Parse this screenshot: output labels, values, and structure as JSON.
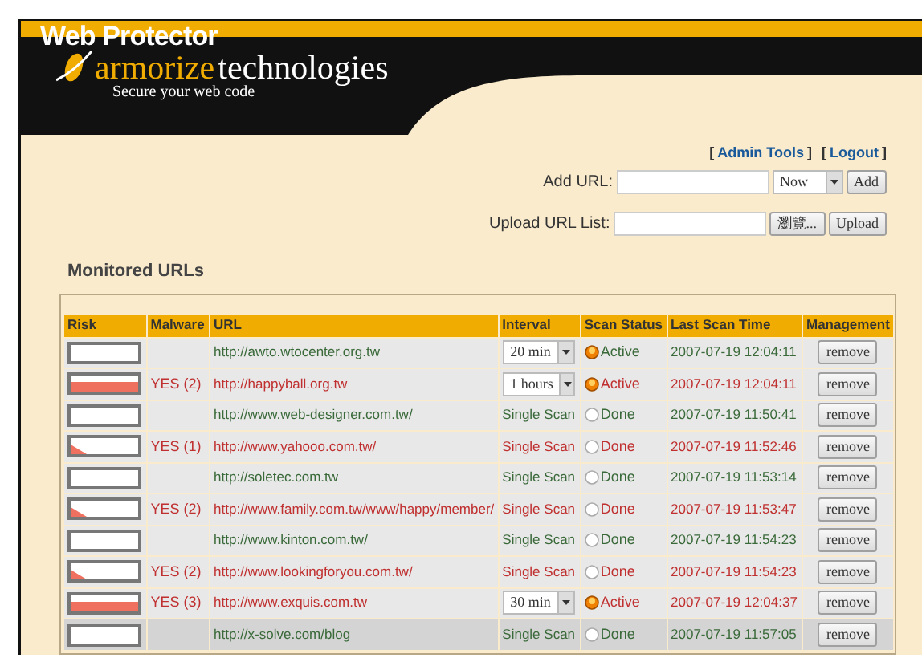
{
  "app": {
    "title": "Web Protector",
    "brand": "armorize",
    "brand_suffix": "technologies",
    "tagline": "Secure your web code"
  },
  "links": [
    {
      "open": "[",
      "label": "Admin Tools",
      "close": "]"
    },
    {
      "open": "[",
      "label": "Logout",
      "close": "]"
    }
  ],
  "add_url": {
    "label": "Add URL:",
    "schedule": "Now",
    "button": "Add"
  },
  "upload": {
    "label": "Upload URL List:",
    "browse": "瀏覽...",
    "button": "Upload"
  },
  "section_title": "Monitored URLs",
  "table": {
    "columns": [
      "Risk",
      "Malware",
      "URL",
      "Interval",
      "Scan Status",
      "Last Scan Time",
      "Management"
    ],
    "rows": [
      {
        "risk": {
          "kind": "none"
        },
        "malware": "",
        "url": "http://awto.wtocenter.org.tw",
        "interval": {
          "kind": "select",
          "label": "20 min"
        },
        "status": {
          "kind": "active",
          "label": "Active"
        },
        "time": "2007-07-19 12:04:11",
        "action": "remove",
        "flagged": false,
        "selected": false
      },
      {
        "risk": {
          "kind": "bar"
        },
        "malware": "YES (2)",
        "url": "http://happyball.org.tw",
        "interval": {
          "kind": "select",
          "label": "1 hours"
        },
        "status": {
          "kind": "active",
          "label": "Active"
        },
        "time": "2007-07-19 12:04:11",
        "action": "remove",
        "flagged": true,
        "selected": false
      },
      {
        "risk": {
          "kind": "none"
        },
        "malware": "",
        "url": "http://www.web-designer.com.tw/",
        "interval": {
          "kind": "text",
          "label": "Single Scan"
        },
        "status": {
          "kind": "done",
          "label": "Done"
        },
        "time": "2007-07-19 11:50:41",
        "action": "remove",
        "flagged": false,
        "selected": false
      },
      {
        "risk": {
          "kind": "wedge"
        },
        "malware": "YES (1)",
        "url": "http://www.yahooo.com.tw/",
        "interval": {
          "kind": "text",
          "label": "Single Scan"
        },
        "status": {
          "kind": "done",
          "label": "Done"
        },
        "time": "2007-07-19 11:52:46",
        "action": "remove",
        "flagged": true,
        "selected": false
      },
      {
        "risk": {
          "kind": "none"
        },
        "malware": "",
        "url": "http://soletec.com.tw",
        "interval": {
          "kind": "text",
          "label": "Single Scan"
        },
        "status": {
          "kind": "done",
          "label": "Done"
        },
        "time": "2007-07-19 11:53:14",
        "action": "remove",
        "flagged": false,
        "selected": false
      },
      {
        "risk": {
          "kind": "wedge"
        },
        "malware": "YES (2)",
        "url": "http://www.family.com.tw/www/happy/member/",
        "interval": {
          "kind": "text",
          "label": "Single Scan"
        },
        "status": {
          "kind": "done",
          "label": "Done"
        },
        "time": "2007-07-19 11:53:47",
        "action": "remove",
        "flagged": true,
        "selected": false
      },
      {
        "risk": {
          "kind": "none"
        },
        "malware": "",
        "url": "http://www.kinton.com.tw/",
        "interval": {
          "kind": "text",
          "label": "Single Scan"
        },
        "status": {
          "kind": "done",
          "label": "Done"
        },
        "time": "2007-07-19 11:54:23",
        "action": "remove",
        "flagged": false,
        "selected": false
      },
      {
        "risk": {
          "kind": "wedge"
        },
        "malware": "YES (2)",
        "url": "http://www.lookingforyou.com.tw/",
        "interval": {
          "kind": "text",
          "label": "Single Scan"
        },
        "status": {
          "kind": "done",
          "label": "Done"
        },
        "time": "2007-07-19 11:54:23",
        "action": "remove",
        "flagged": true,
        "selected": false
      },
      {
        "risk": {
          "kind": "bar"
        },
        "malware": "YES (3)",
        "url": "http://www.exquis.com.tw",
        "interval": {
          "kind": "select",
          "label": "30 min"
        },
        "status": {
          "kind": "active",
          "label": "Active"
        },
        "time": "2007-07-19 12:04:37",
        "action": "remove",
        "flagged": true,
        "selected": false
      },
      {
        "risk": {
          "kind": "none"
        },
        "malware": "",
        "url": "http://x-solve.com/blog",
        "interval": {
          "kind": "text",
          "label": "Single Scan"
        },
        "status": {
          "kind": "done",
          "label": "Done"
        },
        "time": "2007-07-19 11:57:05",
        "action": "remove",
        "flagged": false,
        "selected": true
      }
    ]
  }
}
